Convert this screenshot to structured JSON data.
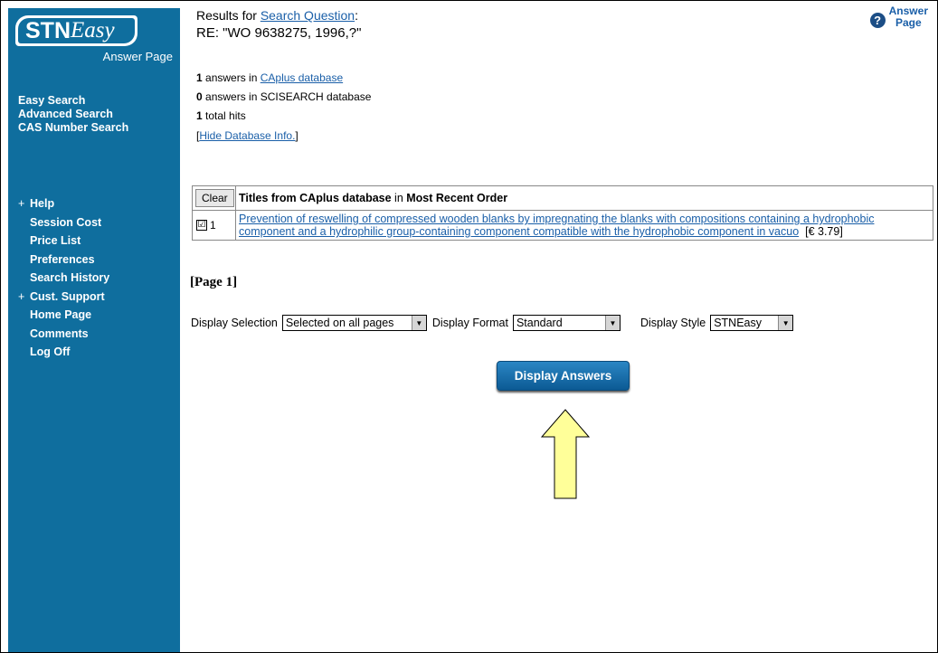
{
  "sidebar": {
    "logo_stn": "STN",
    "logo_easy": "Easy",
    "page_label": "Answer Page",
    "top_links": [
      "Easy Search",
      "Advanced Search",
      "CAS Number Search"
    ],
    "menu": [
      {
        "label": "Help",
        "plus": true
      },
      {
        "label": "Session Cost",
        "plus": false
      },
      {
        "label": "Price List",
        "plus": false
      },
      {
        "label": "Preferences",
        "plus": false
      },
      {
        "label": "Search History",
        "plus": false
      },
      {
        "label": "Cust. Support",
        "plus": true
      },
      {
        "label": "Home Page",
        "plus": false
      },
      {
        "label": "Comments",
        "plus": false
      },
      {
        "label": "Log Off",
        "plus": false
      }
    ],
    "plus_symbol": "+"
  },
  "header": {
    "results_for": "Results for ",
    "search_question_link": "Search Question",
    "colon": ":",
    "query": "RE: \"WO 9638275, 1996,?\""
  },
  "help": {
    "icon": "?",
    "line1": "Answer",
    "line2": "Page"
  },
  "stats": {
    "caplus_count": "1",
    "caplus_mid": " answers in ",
    "caplus_link": "CAplus database",
    "scisearch_count": "0",
    "scisearch_text": " answers in SCISEARCH database",
    "total_count": "1",
    "total_text": " total hits",
    "hide_open": "[",
    "hide_link": "Hide Database Info.",
    "hide_close": "]"
  },
  "table": {
    "clear_label": "Clear",
    "header_bold1": "Titles from CAplus database",
    "header_mid": " in ",
    "header_bold2": "Most Recent Order",
    "rows": [
      {
        "checked": "☑",
        "number": "1",
        "title": "Prevention of reswelling of compressed wooden blanks by impregnating the blanks with compositions containing a hydrophobic component and a hydrophilic group-containing component compatible with the hydrophobic component in vacuo",
        "price": "[€ 3.79]"
      }
    ]
  },
  "page_label": "[Page 1]",
  "controls": {
    "selection_label": "Display Selection",
    "selection_value": "Selected on all pages",
    "format_label": "Display Format",
    "format_value": "Standard",
    "style_label": "Display Style",
    "style_value": "STNEasy",
    "arrow_glyph": "▼"
  },
  "display_button": "Display Answers",
  "colors": {
    "sidebar": "#0f6e9e",
    "link": "#1a5fa8",
    "button": "#0c5a94",
    "arrow_fill": "#ffff99"
  }
}
